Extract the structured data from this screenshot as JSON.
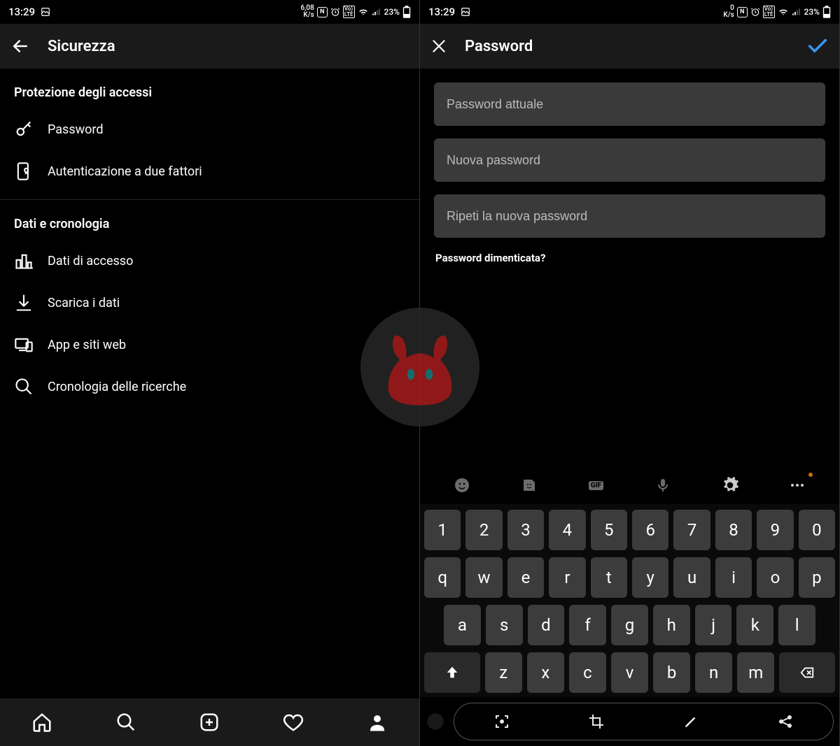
{
  "status": {
    "time": "13:29",
    "speed_left": "6,08",
    "speed_right": "0",
    "speed_unit": "K/s",
    "battery": "23%"
  },
  "left": {
    "title": "Sicurezza",
    "section1": "Protezione degli accessi",
    "items1": {
      "password": "Password",
      "twofa": "Autenticazione a due fattori"
    },
    "section2": "Dati e cronologia",
    "items2": {
      "access": "Dati di accesso",
      "download": "Scarica i dati",
      "apps": "App e siti web",
      "history": "Cronologia delle ricerche"
    }
  },
  "right": {
    "title": "Password",
    "ph_current": "Password attuale",
    "ph_new": "Nuova password",
    "ph_repeat": "Ripeti la nuova password",
    "forgot": "Password dimenticata?"
  },
  "keyboard": {
    "gif": "GIF",
    "row1": [
      "1",
      "2",
      "3",
      "4",
      "5",
      "6",
      "7",
      "8",
      "9",
      "0"
    ],
    "row2": [
      "q",
      "w",
      "e",
      "r",
      "t",
      "y",
      "u",
      "i",
      "o",
      "p"
    ],
    "row3": [
      "a",
      "s",
      "d",
      "f",
      "g",
      "h",
      "j",
      "k",
      "l"
    ],
    "row4": [
      "z",
      "x",
      "c",
      "v",
      "b",
      "n",
      "m"
    ]
  }
}
